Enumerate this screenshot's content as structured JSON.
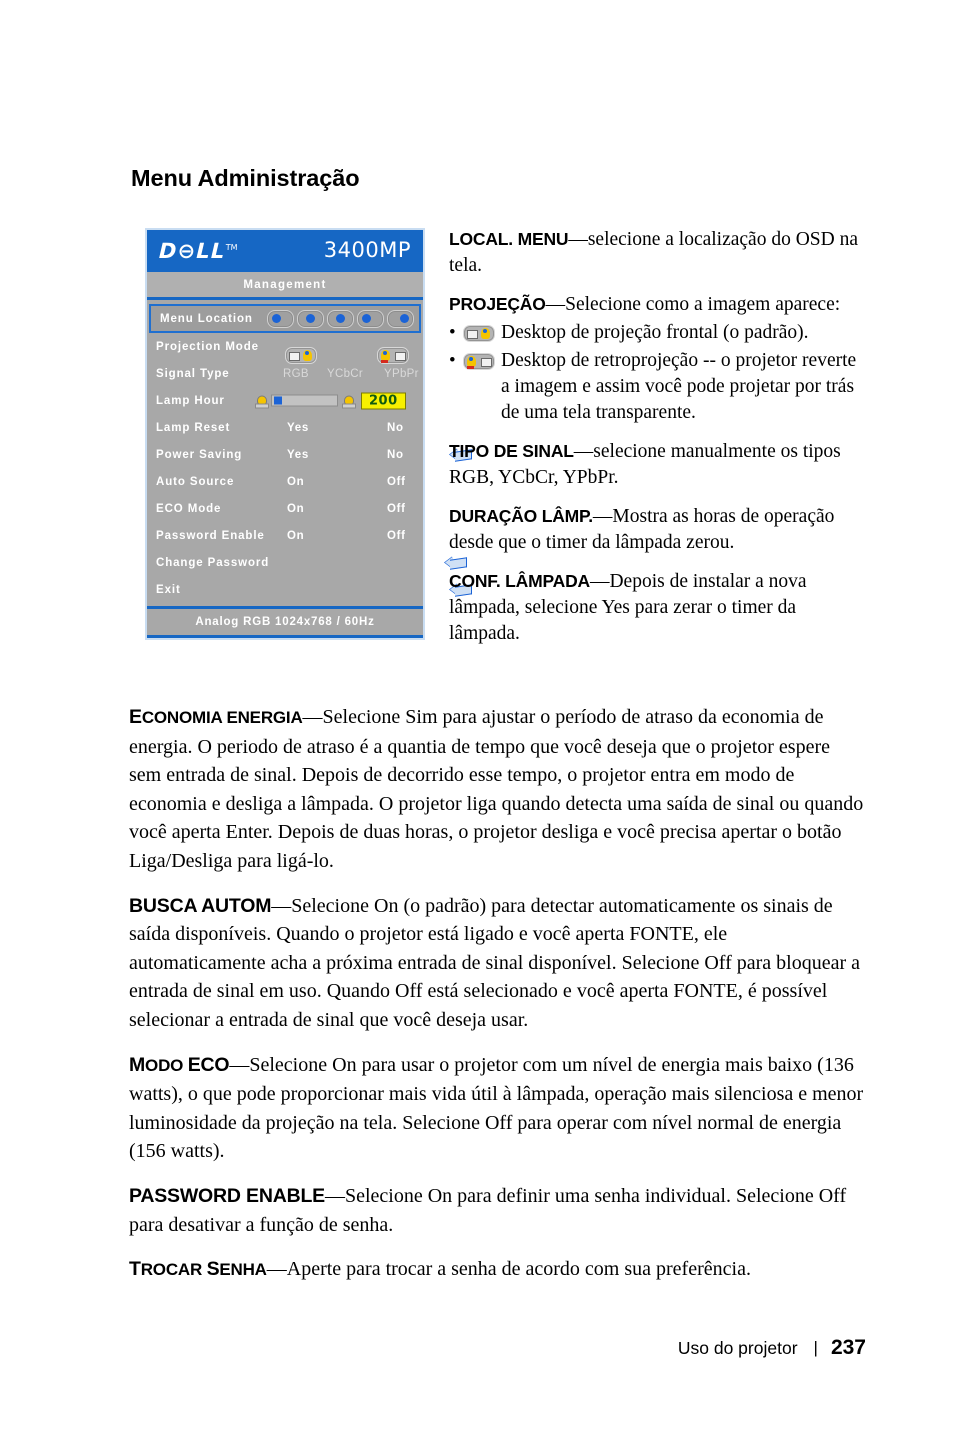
{
  "page": {
    "section_title": "Menu Administração",
    "footer": {
      "label": "Uso do projetor",
      "separator": "|",
      "page_number": "237"
    }
  },
  "osd": {
    "brand": "D∠LL",
    "brand_text": "DELL",
    "trademark": "TM",
    "model": "3400MP",
    "tab": "Management",
    "status_bar": "Analog RGB 1024x768 / 60Hz",
    "rows": [
      {
        "label": "Menu Location",
        "type": "location",
        "selected": true,
        "options": [
          "top-left",
          "top-right",
          "center",
          "bottom-left",
          "bottom-right"
        ]
      },
      {
        "label": "Projection Mode",
        "type": "projection",
        "options": [
          "front-desktop",
          "rear-desktop"
        ]
      },
      {
        "label": "Signal Type",
        "type": "signal",
        "values": [
          "RGB",
          "YCbCr",
          "YPbPr"
        ]
      },
      {
        "label": "Lamp Hour",
        "type": "slider",
        "value": "200"
      },
      {
        "label": "Lamp Reset",
        "type": "yesno",
        "values": [
          "Yes",
          "No"
        ]
      },
      {
        "label": "Power Saving",
        "type": "yesno-arrow",
        "values": [
          "Yes",
          "No"
        ]
      },
      {
        "label": "Auto Source",
        "type": "onoff",
        "values": [
          "On",
          "Off"
        ]
      },
      {
        "label": "ECO Mode",
        "type": "onoff",
        "values": [
          "On",
          "Off"
        ]
      },
      {
        "label": "Password Enable",
        "type": "onoff",
        "values": [
          "On",
          "Off"
        ]
      },
      {
        "label": "Change Password",
        "type": "arrow"
      },
      {
        "label": "Exit",
        "type": "arrow"
      }
    ]
  },
  "right_column": {
    "local_menu": {
      "term": "LOCAL. MENU",
      "body": "—selecione a localização do OSD na tela."
    },
    "projecao": {
      "term": "PROJEÇÃO",
      "body": "—Selecione como a imagem aparece:",
      "bullets": [
        {
          "icon": "front-projection-icon",
          "text": "Desktop de projeção frontal (o padrão)."
        },
        {
          "icon": "rear-projection-icon",
          "text": "Desktop de retroprojeção -- o projetor reverte a imagem e assim você pode projetar por trás de uma tela transparente."
        }
      ]
    },
    "tipo_sinal": {
      "term": "TIPO DE SINAL",
      "body": "—selecione manualmente os tipos RGB, YCbCr, YPbPr."
    },
    "duracao_lamp": {
      "term": "DURAÇÃO LÂMP.",
      "body": "—Mostra as horas de operação desde que o timer da lâmpada zerou."
    },
    "conf_lampada": {
      "term": "CONF. LÂMPADA",
      "body": "—Depois de instalar a nova lâmpada, selecione Yes para zerar o timer da lâmpada."
    }
  },
  "body": {
    "economia_energia": {
      "term": "Economia energia",
      "term_cap": "E",
      "term_rest": "CONOMIA ENERGIA",
      "body": "—Selecione Sim para ajustar o período de atraso da economia de energia. O periodo de atraso é a quantia de tempo que você deseja que o projetor espere sem entrada de sinal. Depois de decorrido esse tempo, o projetor entra em modo de economia e desliga a lâmpada. O projetor liga quando detecta uma saída de sinal ou quando você aperta Enter. Depois de duas horas, o projetor desliga e você precisa apertar o botão Liga/Desliga para ligá-lo."
    },
    "busca_autom": {
      "term": "BUSCA AUTOM",
      "part1": "—Selecione On (o padrão) para detectar automaticamente os sinais de saída disponíveis. Quando o projetor está ligado e você aperta ",
      "fonte1": "FONTE",
      "part2": ", ele automaticamente acha a próxima entrada de sinal disponível. Selecione Off para bloquear a entrada de sinal em uso. Quando Off está selecionado e você aperta ",
      "fonte2": "FONTE",
      "part3": ", é possível selecionar a entrada de sinal que você deseja usar."
    },
    "modo_eco": {
      "term_cap": "M",
      "term_rest": "ODO ",
      "term_tail": "ECO",
      "body": "—Selecione On para usar o projetor com um nível de energia mais baixo (136 watts), o que pode proporcionar mais vida útil à lâmpada, operação mais silenciosa e menor luminosidade da projeção na tela. Selecione Off para operar com nível normal de energia (156 watts)."
    },
    "password_enable": {
      "term": "PASSWORD ENABLE",
      "body": "—Selecione On para definir uma senha individual. Selecione Off para desativar a função de senha."
    },
    "trocar_senha": {
      "term_t": "T",
      "term_rocar": "ROCAR ",
      "term_s": "S",
      "term_enha": "ENHA",
      "body": "—Aperte para trocar a senha de acordo com sua preferência."
    }
  },
  "colors": {
    "osd_blue": "#1667c4",
    "osd_gray": "#a8a8a8",
    "highlight_yellow": "#f7f000",
    "dot_blue": "#1b63d6"
  }
}
